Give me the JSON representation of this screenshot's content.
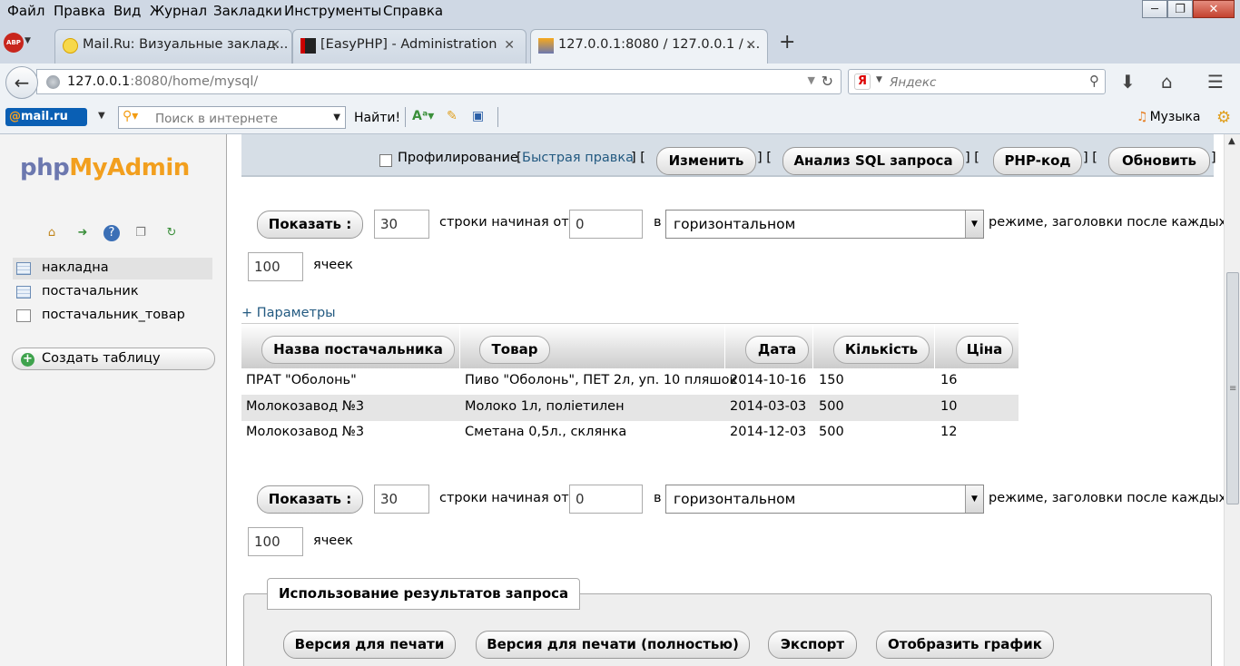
{
  "menu": [
    "Файл",
    "Правка",
    "Вид",
    "Журнал",
    "Закладки",
    "Инструменты",
    "Справка"
  ],
  "tabs": [
    {
      "title": "Mail.Ru: Визуальные заклад..."
    },
    {
      "title": "[EasyPHP] - Administration"
    },
    {
      "title": "127.0.0.1:8080 / 127.0.0.1 / ..."
    }
  ],
  "address": {
    "host": "127.0.0.1",
    "rest": ":8080/home/mysql/"
  },
  "search_placeholder": "Яндекс",
  "mailru": {
    "logo_at": "@",
    "logo_text": "mail.ru",
    "search_placeholder": "Поиск в интернете",
    "go_label": "Найти!",
    "music_label": "Музыка"
  },
  "nav": {
    "tables": [
      "накладна",
      "постачальник",
      "постачальник_товар"
    ],
    "create_table": "Создать таблицу"
  },
  "actionbar": {
    "profiling": "Профилирование",
    "bracket_open": "[",
    "quick_edit": "Быстрая правка",
    "bracket_sep": "] [",
    "bracket_close": "]",
    "edit": "Изменить",
    "explain": "Анализ SQL запроса",
    "php_code": "PHP-код",
    "refresh": "Обновить"
  },
  "nav_controls": {
    "show_label": "Показать :",
    "rows_value": "30",
    "start_label": "строки начиная от",
    "start_value": "0",
    "in_label": "в",
    "mode_value": "горизонтальном",
    "mode_tail": "режиме, заголовки после каждых",
    "cells_value": "100",
    "cells_label": "ячеек"
  },
  "options_link": "+ Параметры",
  "table": {
    "headers": [
      "Назва постачальника",
      "Товар",
      "Дата",
      "Кількість",
      "Ціна"
    ],
    "rows": [
      [
        "ПРАТ \"Оболонь\"",
        "Пиво \"Оболонь\", ПЕТ 2л, уп. 10 пляшок",
        "2014-10-16",
        "150",
        "16"
      ],
      [
        "Молокозавод №3",
        "Молоко 1л, поліетилен",
        "2014-03-03",
        "500",
        "10"
      ],
      [
        "Молокозавод №3",
        "Сметана 0,5л., склянка",
        "2014-12-03",
        "500",
        "12"
      ]
    ]
  },
  "results": {
    "legend": "Использование результатов запроса",
    "buttons": [
      "Версия для печати",
      "Версия для печати (полностью)",
      "Экспорт",
      "Отобразить график"
    ]
  }
}
